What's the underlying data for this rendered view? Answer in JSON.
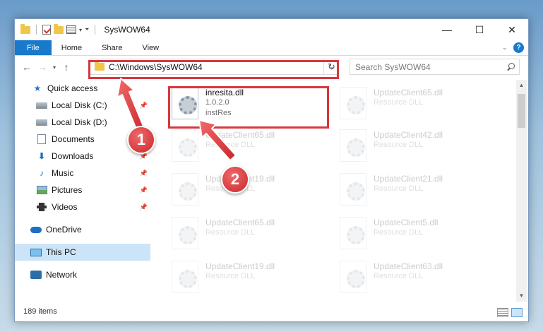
{
  "window": {
    "title": "SysWOW64",
    "controls": {
      "minimize": "—",
      "maximize": "☐",
      "close": "✕"
    }
  },
  "ribbon": {
    "tabs": [
      "File",
      "Home",
      "Share",
      "View"
    ]
  },
  "address": {
    "path": "C:\\Windows\\SysWOW64"
  },
  "search": {
    "placeholder": "Search SysWOW64"
  },
  "sidebar": {
    "items": [
      {
        "label": "Quick access",
        "icon": "star-icon",
        "pinned": false
      },
      {
        "label": "Local Disk (C:)",
        "icon": "disk-icon",
        "pinned": true
      },
      {
        "label": "Local Disk (D:)",
        "icon": "disk-icon",
        "pinned": false
      },
      {
        "label": "Documents",
        "icon": "documents-icon",
        "pinned": true
      },
      {
        "label": "Downloads",
        "icon": "downloads-icon",
        "pinned": true
      },
      {
        "label": "Music",
        "icon": "music-icon",
        "pinned": true
      },
      {
        "label": "Pictures",
        "icon": "pictures-icon",
        "pinned": true
      },
      {
        "label": "Videos",
        "icon": "videos-icon",
        "pinned": true
      },
      {
        "label": "OneDrive",
        "icon": "onedrive-icon",
        "pinned": false
      },
      {
        "label": "This PC",
        "icon": "pc-icon",
        "pinned": false,
        "selected": true
      },
      {
        "label": "Network",
        "icon": "network-icon",
        "pinned": false
      }
    ]
  },
  "files": {
    "highlighted": {
      "name": "inresita.dll",
      "version": "1.0.2.0",
      "company": "instRes"
    },
    "faded_left": [
      {
        "name": "UpdateClient65.dll",
        "type": "Resource DLL"
      },
      {
        "name": "UpdateClient19.dll",
        "type": "Resource DLL"
      },
      {
        "name": "UpdateClient65.dll",
        "type": "Resource DLL"
      },
      {
        "name": "UpdateClient19.dll",
        "type": "Resource DLL"
      }
    ],
    "faded_right": [
      {
        "name": "UpdateClient65.dll",
        "type": "Resource DLL"
      },
      {
        "name": "UpdateClient42.dll",
        "type": "Resource DLL"
      },
      {
        "name": "UpdateClient21.dll",
        "type": "Resource DLL"
      },
      {
        "name": "UpdateClient5.dll",
        "type": "Resource DLL"
      },
      {
        "name": "UpdateClient63.dll",
        "type": "Resource DLL"
      }
    ]
  },
  "status": {
    "item_count": "189 items"
  },
  "annotations": {
    "badge1": "1",
    "badge2": "2",
    "accent": "#d9363e"
  }
}
